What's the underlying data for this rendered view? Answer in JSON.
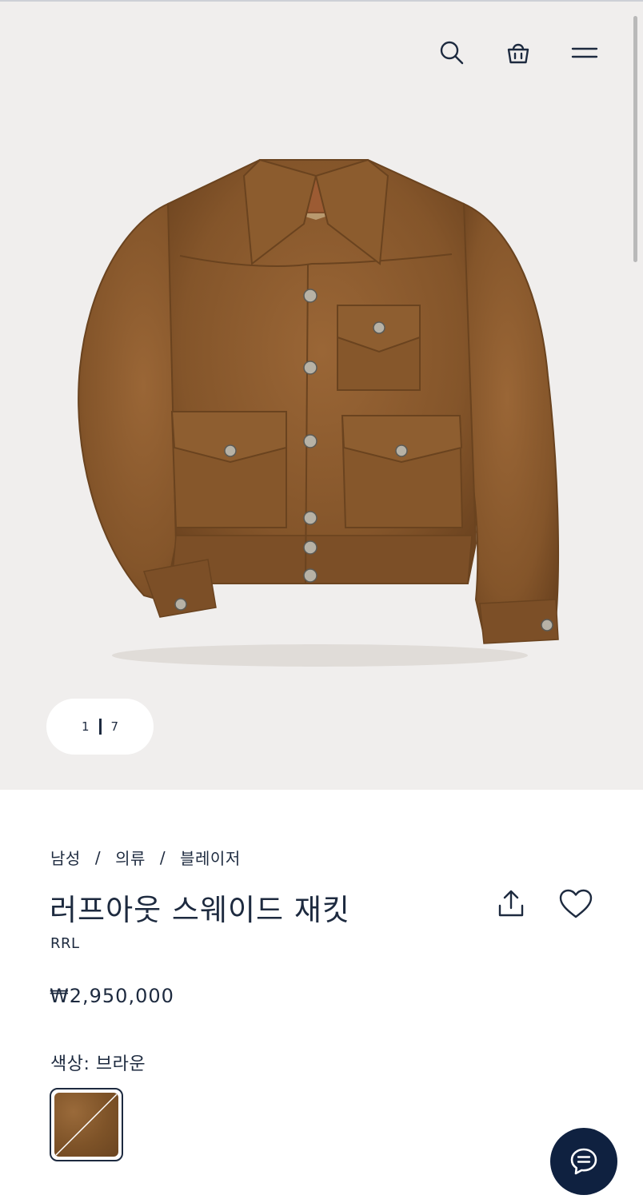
{
  "header": {
    "icons": [
      "search-icon",
      "shopping-bag-icon",
      "menu-icon"
    ]
  },
  "gallery": {
    "current": "1",
    "total": "7"
  },
  "breadcrumb": {
    "items": [
      "남성",
      "의류",
      "블레이저"
    ],
    "separator": "/"
  },
  "product": {
    "title": "러프아웃 스웨이드 재킷",
    "brand": "RRL",
    "price": "₩2,950,000",
    "color_label": "색상: 브라운",
    "actions": [
      "share-icon",
      "heart-icon"
    ]
  },
  "swatches": [
    {
      "name": "브라운",
      "color": "#7e5328",
      "selected": true
    }
  ],
  "chat": {
    "icon": "chat-icon"
  },
  "colors": {
    "hero_bg": "#f0eeed",
    "navy": "#1d2a3f",
    "chat_bg": "#0f2140",
    "suede": "#8a5b2e"
  }
}
